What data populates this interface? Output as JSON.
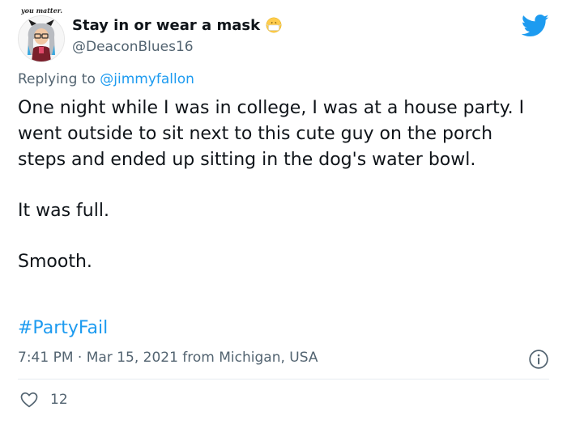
{
  "user": {
    "display_name": "Stay in or wear a mask",
    "handle": "@DeaconBlues16",
    "avatar_caption": "you matter.",
    "name_emoji": "face-with-medical-mask-icon"
  },
  "reply": {
    "prefix": "Replying to",
    "mention": "@jimmyfallon"
  },
  "tweet": {
    "paragraphs": [
      "One night while I was in college, I was at a house party. I went outside to sit next to this cute guy on the porch steps and ended up sitting in the dog's water bowl.",
      "It was full.",
      "Smooth."
    ],
    "hashtag": "#PartyFail",
    "meta": "7:41 PM · Mar 15, 2021 from Michigan, USA"
  },
  "engagement": {
    "likes": "12"
  },
  "icons": {
    "brand": "twitter-bird-icon",
    "info": "info-icon",
    "like": "heart-icon"
  },
  "colors": {
    "twitter_blue": "#1d9bf0",
    "secondary_text": "#536471",
    "primary_text": "#0f1419"
  }
}
